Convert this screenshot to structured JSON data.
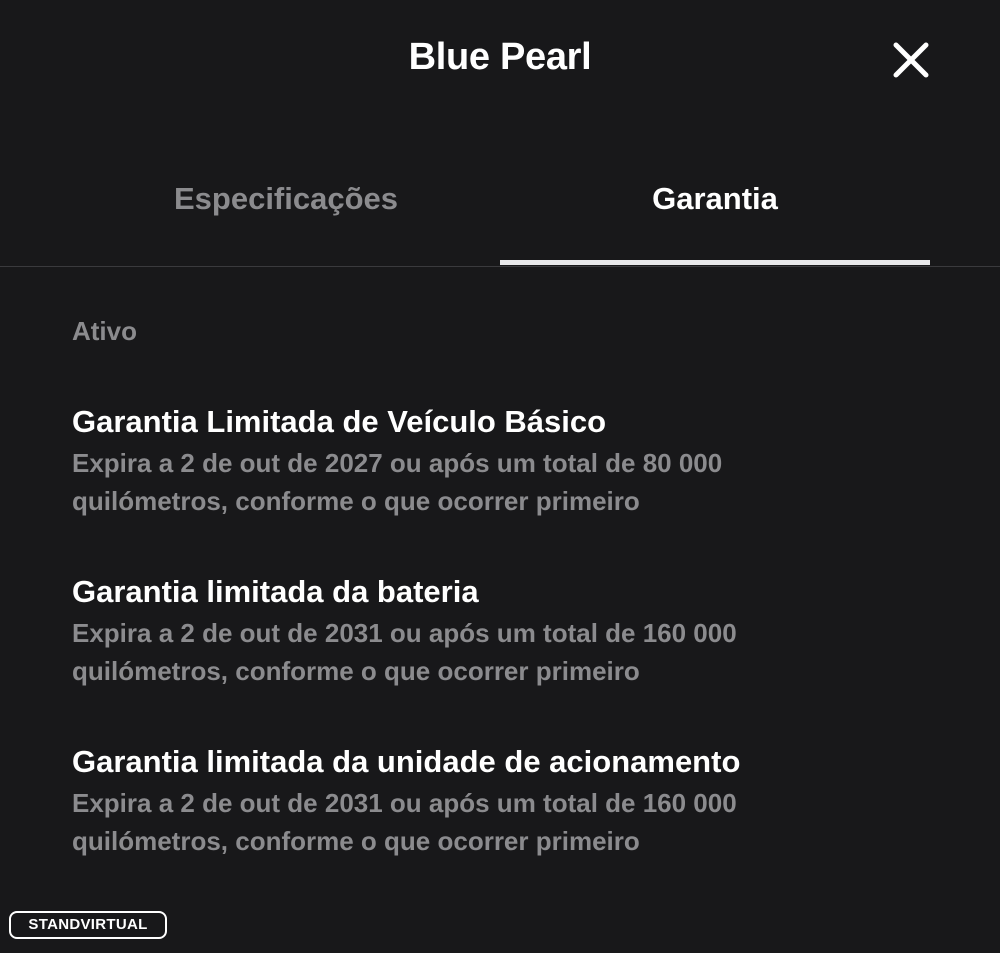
{
  "header": {
    "title": "Blue Pearl",
    "close_icon": "close-icon"
  },
  "tabs": [
    {
      "label": "Especificações",
      "active": false
    },
    {
      "label": "Garantia",
      "active": true
    }
  ],
  "section": {
    "label": "Ativo"
  },
  "warranties": [
    {
      "title": "Garantia Limitada de Veículo Básico",
      "description": "Expira a 2 de out de 2027 ou após um total de 80 000 quilómetros, conforme o que ocorrer primeiro"
    },
    {
      "title": "Garantia limitada da bateria",
      "description": "Expira a 2 de out de 2031 ou após um total de 160 000 quilómetros, conforme o que ocorrer primeiro"
    },
    {
      "title": "Garantia limitada da unidade de acionamento",
      "description": "Expira a 2 de out de 2031 ou após um total de 160 000 quilómetros, conforme o que ocorrer primeiro"
    }
  ],
  "watermark": {
    "text": "STANDVIRTUAL"
  },
  "colors": {
    "background": "#18181a",
    "primary_text": "#ffffff",
    "secondary_text": "#8b8b8e",
    "divider": "#3a3a3d",
    "tab_indicator": "#e8e8ea"
  }
}
